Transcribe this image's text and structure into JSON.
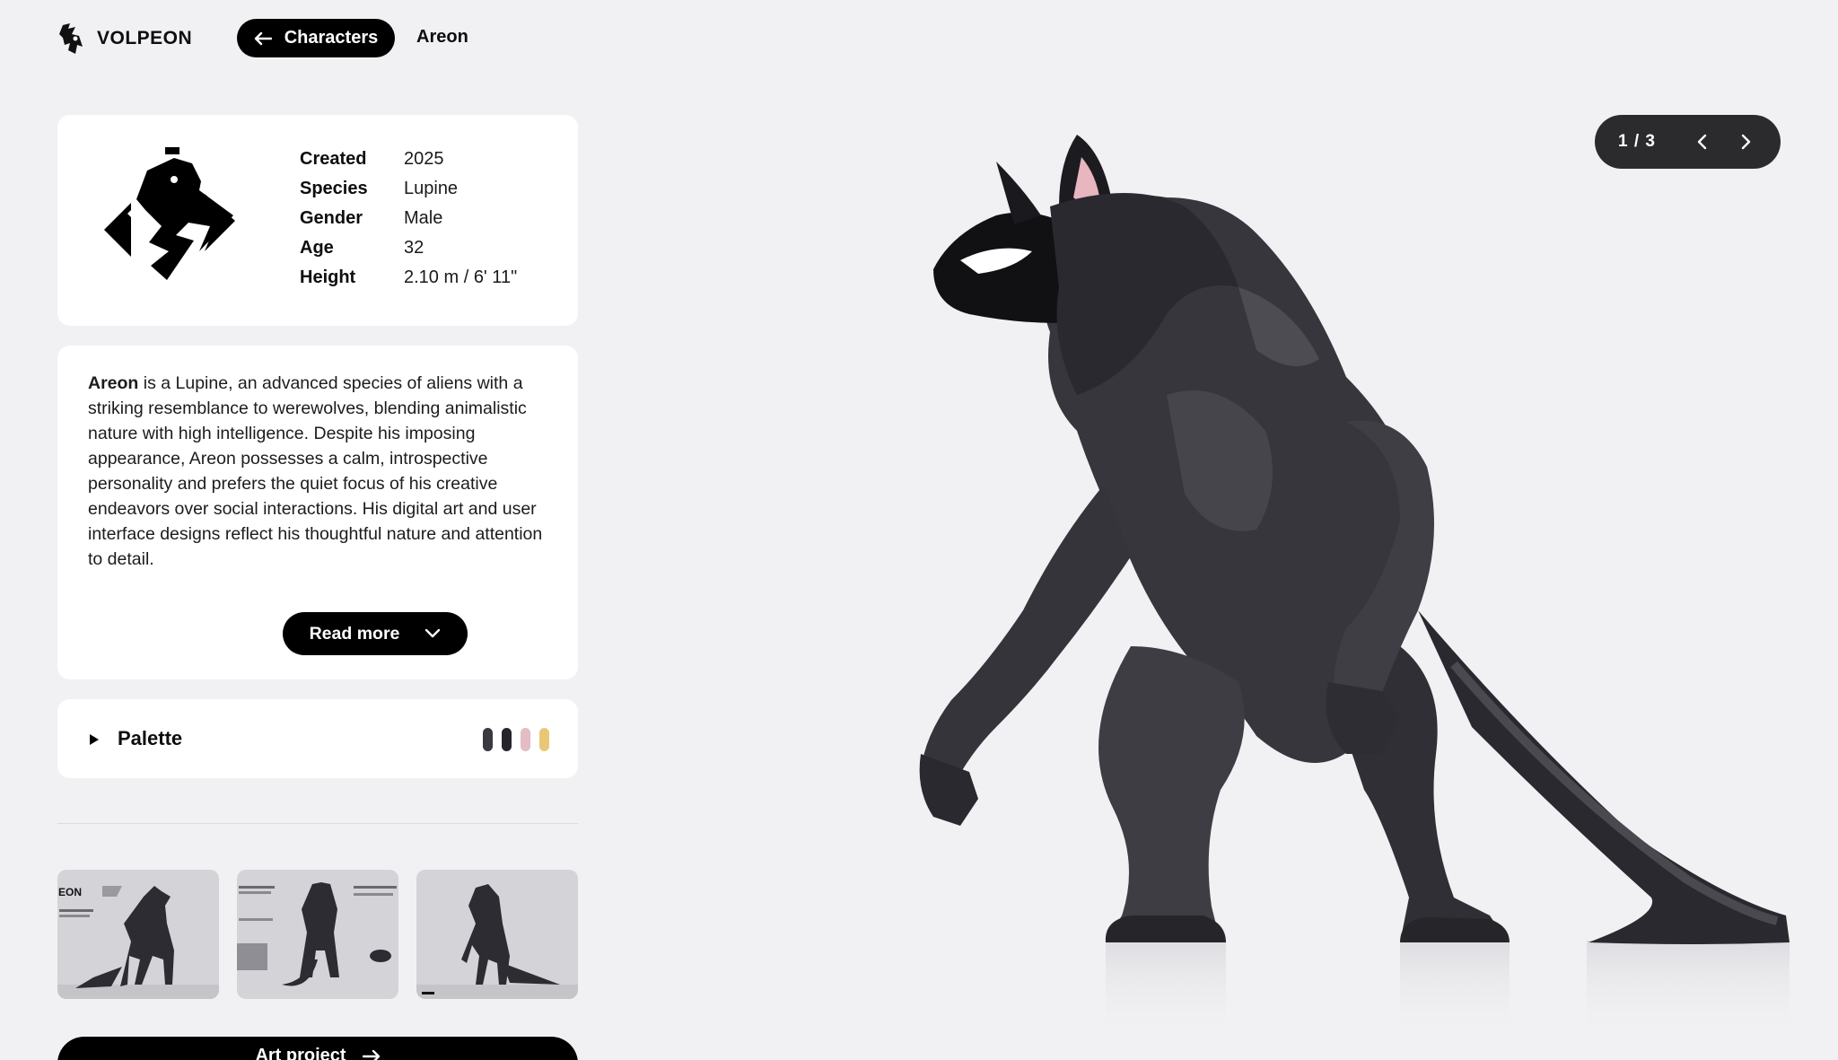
{
  "brand": {
    "name": "VOLPEON",
    "logo_icon": "volpeon-fox-logo-icon"
  },
  "header": {
    "back_label": "Characters",
    "current": "Areon"
  },
  "profile": {
    "stats": [
      {
        "key": "Created",
        "value": "2025"
      },
      {
        "key": "Species",
        "value": "Lupine"
      },
      {
        "key": "Gender",
        "value": "Male"
      },
      {
        "key": "Age",
        "value": "32"
      },
      {
        "key": "Height",
        "value": "2.10 m / 6' 11\""
      }
    ]
  },
  "bio": {
    "name": "Areon",
    "text": " is a Lupine, an advanced species of aliens with a striking resemblance to werewolves, blending animalistic nature with high intelligence. Despite his imposing appearance, Areon possesses a calm, introspective personality and prefers the quiet focus of his creative endeavors over social interactions. His digital art and user interface designs reflect his thoughtful nature and attention to detail.",
    "read_more_label": "Read more"
  },
  "palette": {
    "label": "Palette",
    "colors": [
      "#3a3940",
      "#26252b",
      "#e3bcc4",
      "#e8c874"
    ]
  },
  "gallery": {
    "thumbs": [
      {
        "label": "EON"
      },
      {
        "label": ""
      },
      {
        "label": ""
      }
    ]
  },
  "art_project_label": "Art project",
  "pager": {
    "count": "1 / 3"
  },
  "colors": {
    "accent": "#000000",
    "background": "#f1f1f4",
    "card": "#ffffff",
    "pager_bg": "#2b2b2e"
  }
}
